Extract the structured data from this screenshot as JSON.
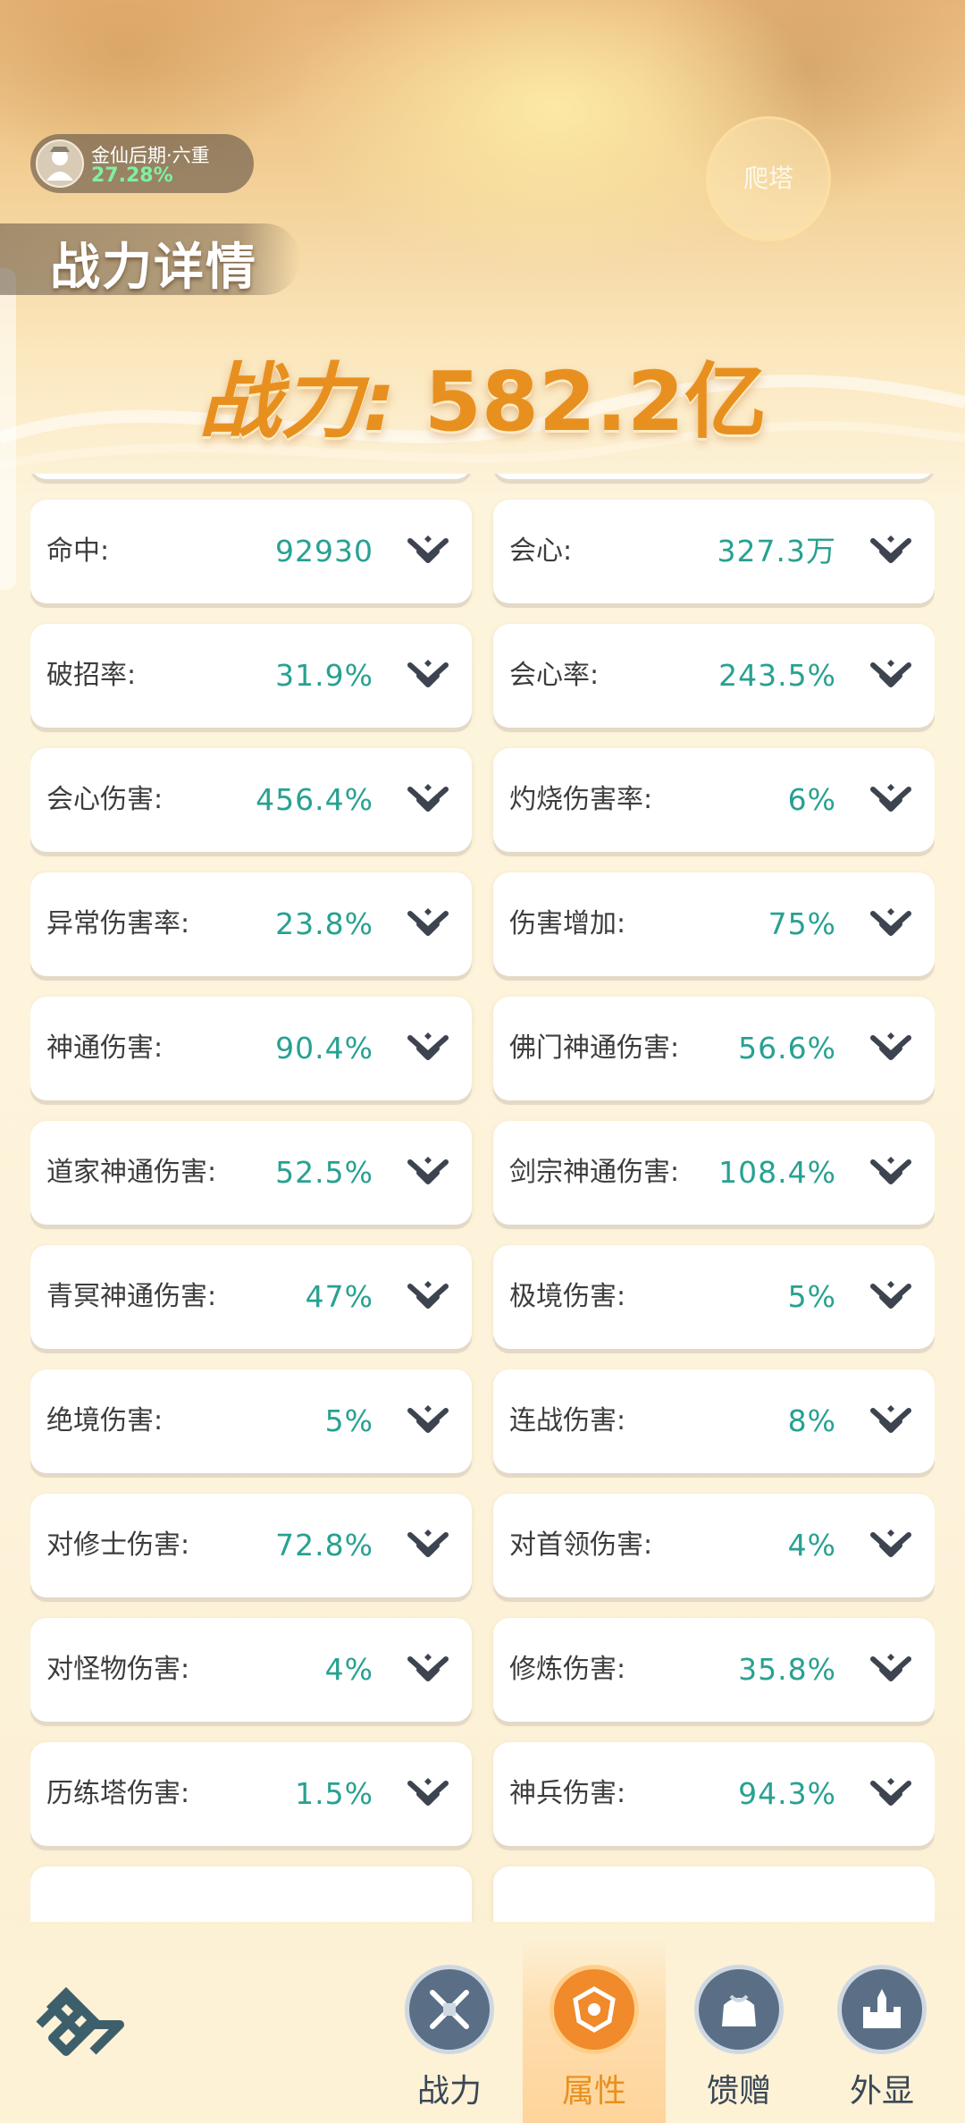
{
  "realm": {
    "name": "金仙后期·六重",
    "progress": "27.28%"
  },
  "tower_button": "爬塔",
  "page_title": "战力详情",
  "power": {
    "label": "战力:",
    "value": "582.2亿"
  },
  "stats": [
    {
      "label": "命中:",
      "value": "92930"
    },
    {
      "label": "会心:",
      "value": "327.3万"
    },
    {
      "label": "破招率:",
      "value": "31.9%"
    },
    {
      "label": "会心率:",
      "value": "243.5%"
    },
    {
      "label": "会心伤害:",
      "value": "456.4%"
    },
    {
      "label": "灼烧伤害率:",
      "value": "6%"
    },
    {
      "label": "异常伤害率:",
      "value": "23.8%"
    },
    {
      "label": "伤害增加:",
      "value": "75%"
    },
    {
      "label": "神通伤害:",
      "value": "90.4%"
    },
    {
      "label": "佛门神通伤害:",
      "value": "56.6%"
    },
    {
      "label": "道家神通伤害:",
      "value": "52.5%"
    },
    {
      "label": "剑宗神通伤害:",
      "value": "108.4%"
    },
    {
      "label": "青冥神通伤害:",
      "value": "47%"
    },
    {
      "label": "极境伤害:",
      "value": "5%"
    },
    {
      "label": "绝境伤害:",
      "value": "5%"
    },
    {
      "label": "连战伤害:",
      "value": "8%"
    },
    {
      "label": "对修士伤害:",
      "value": "72.8%"
    },
    {
      "label": "对首领伤害:",
      "value": "4%"
    },
    {
      "label": "对怪物伤害:",
      "value": "4%"
    },
    {
      "label": "修炼伤害:",
      "value": "35.8%"
    },
    {
      "label": "历练塔伤害:",
      "value": "1.5%"
    },
    {
      "label": "神兵伤害:",
      "value": "94.3%"
    }
  ],
  "nav": [
    {
      "label": "战力",
      "icon": "sword-shield-icon",
      "active": false
    },
    {
      "label": "属性",
      "icon": "emblem-icon",
      "active": true
    },
    {
      "label": "馈赠",
      "icon": "gift-bag-icon",
      "active": false
    },
    {
      "label": "外显",
      "icon": "castle-icon",
      "active": false
    }
  ],
  "colors": {
    "value": "#28a191",
    "power": "#e8901f",
    "nav_active": "#e8901f",
    "nav_text": "#3a4755"
  }
}
